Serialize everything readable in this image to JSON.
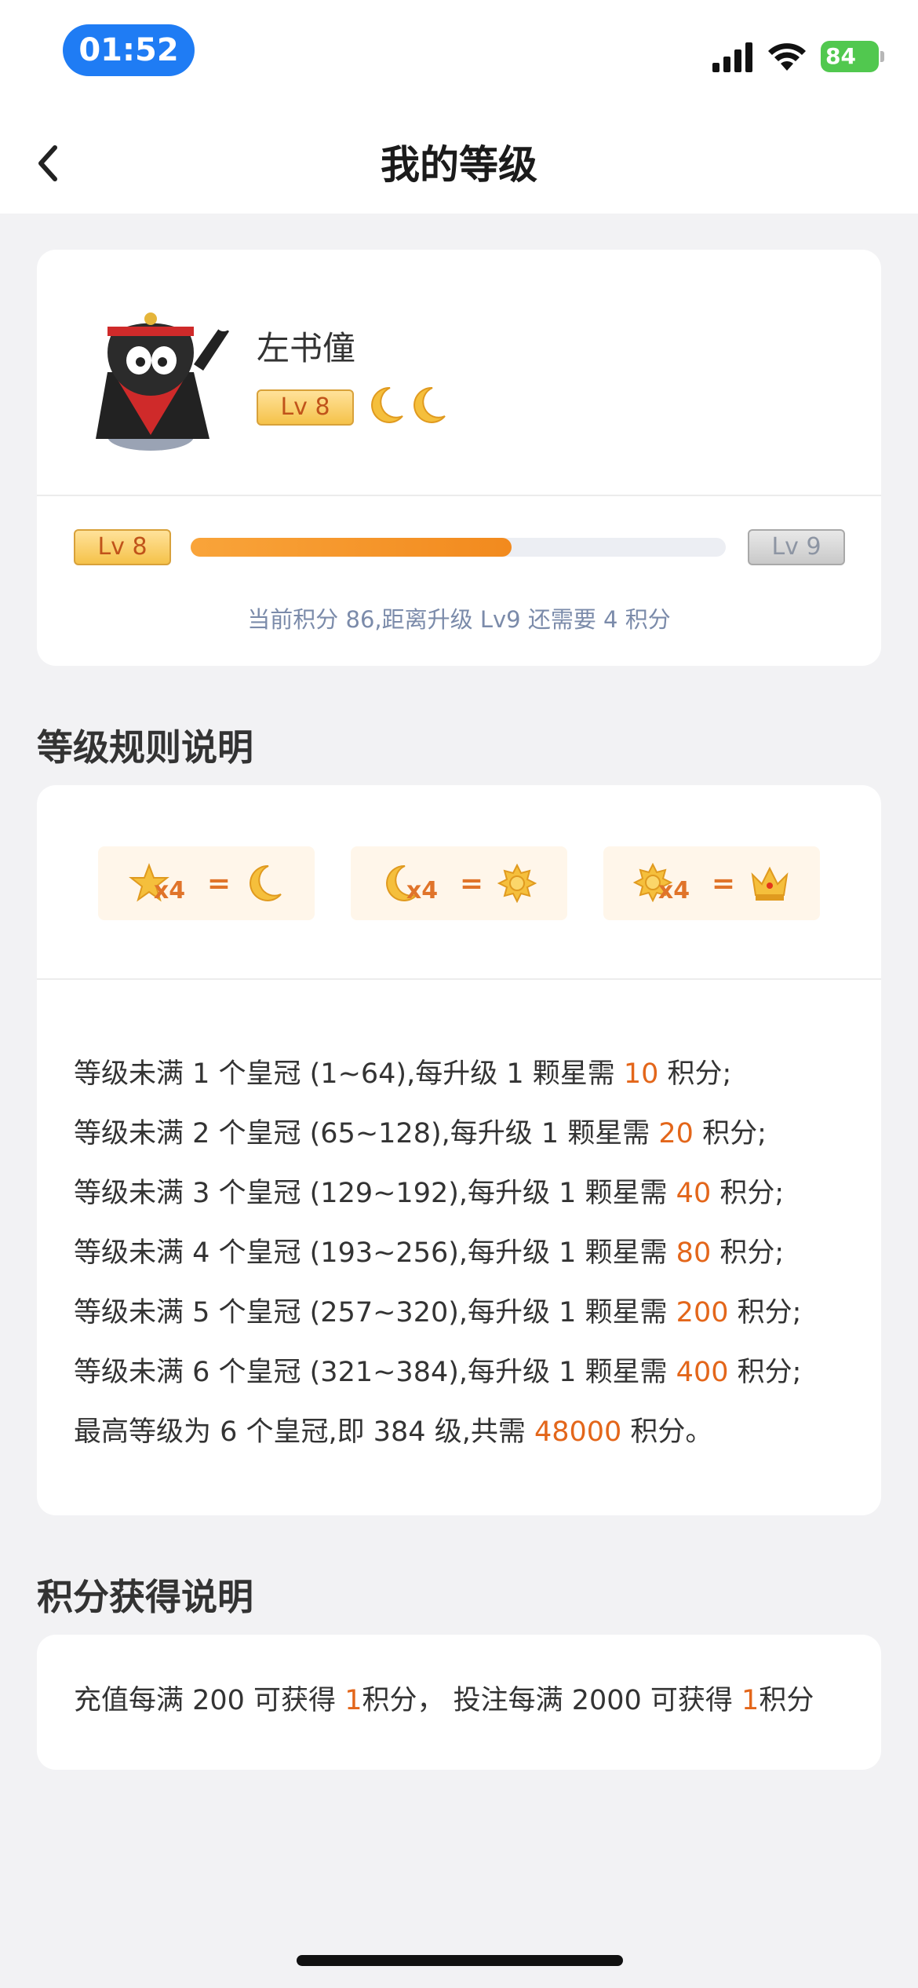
{
  "status_bar": {
    "time": "01:52",
    "battery": "84"
  },
  "nav": {
    "title": "我的等级"
  },
  "profile": {
    "username": "左书僮",
    "level_badge": "Lv 8",
    "progress": {
      "current_level": "Lv 8",
      "next_level": "Lv 9",
      "fraction": 0.6,
      "text": "当前积分 86,距离升级 Lv9 还需要 4 积分"
    }
  },
  "rules": {
    "title": "等级规则说明",
    "equations": [
      {
        "from": "star-icon",
        "multiplier": "x4",
        "equals": "=",
        "to": "moon-icon"
      },
      {
        "from": "moon-icon",
        "multiplier": "x4",
        "equals": "=",
        "to": "sun-icon"
      },
      {
        "from": "sun-icon",
        "multiplier": "x4",
        "equals": "=",
        "to": "crown-icon"
      }
    ],
    "items": [
      {
        "before": "等级未满 1 个皇冠 (1~64),每升级 1 颗星需 ",
        "value": "10",
        "after": " 积分;"
      },
      {
        "before": "等级未满 2 个皇冠 (65~128),每升级 1 颗星需 ",
        "value": "20",
        "after": " 积分;"
      },
      {
        "before": "等级未满 3 个皇冠 (129~192),每升级 1 颗星需 ",
        "value": "40",
        "after": " 积分;"
      },
      {
        "before": "等级未满 4 个皇冠 (193~256),每升级 1 颗星需 ",
        "value": "80",
        "after": " 积分;"
      },
      {
        "before": "等级未满 5 个皇冠 (257~320),每升级 1 颗星需 ",
        "value": "200",
        "after": " 积分;"
      },
      {
        "before": "等级未满 6 个皇冠 (321~384),每升级 1 颗星需 ",
        "value": "400",
        "after": " 积分;"
      },
      {
        "before": "最高等级为 6 个皇冠,即 384 级,共需 ",
        "value": "48000",
        "after": " 积分。"
      }
    ]
  },
  "points": {
    "title": "积分获得说明",
    "part1": "充值每满 200 可获得 ",
    "value1": "1",
    "part2": "积分， 投注每满 2000 可获得 ",
    "value2": "1",
    "part3": "积分"
  },
  "colors": {
    "accent": "#e3661a",
    "progress": "#f28a1e",
    "status_blue": "#1f7cf4"
  }
}
